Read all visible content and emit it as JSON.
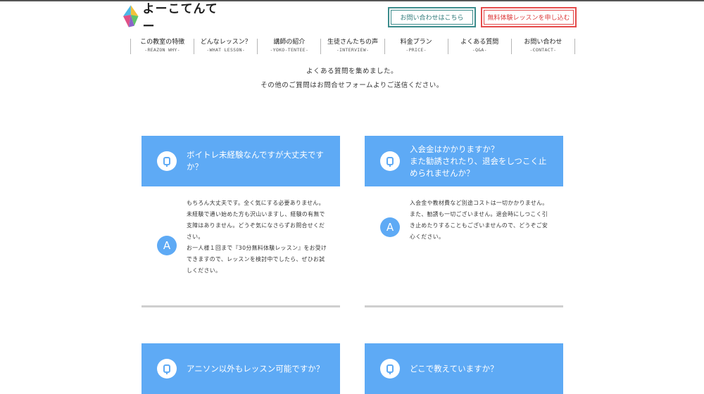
{
  "header": {
    "logo_text": "よーこてんてー",
    "contact_button": "お問い合わせはこちら",
    "trial_button": "無料体験レッスンを申し込む",
    "colors": {
      "contact": "#3c8c8c",
      "trial": "#e44b4b",
      "accent": "#5eaaf5"
    }
  },
  "nav": [
    {
      "ja": "この教室の特徴",
      "en": "-REAZON WHY-"
    },
    {
      "ja": "どんなレッスン？",
      "en": "-WHAT LESSON-"
    },
    {
      "ja": "講師の紹介",
      "en": "-YOKO-TENTEE-"
    },
    {
      "ja": "生徒さんたちの声",
      "en": "-INTERVIEW-"
    },
    {
      "ja": "料金プラン",
      "en": "-PRICE-"
    },
    {
      "ja": "よくある質問",
      "en": "-Q&A-"
    },
    {
      "ja": "お問い合わせ",
      "en": "-CONTACT-"
    }
  ],
  "intro": {
    "line1": "よくある質問を集めました。",
    "line2": "その他のご質問はお問合せフォームよりご送信ください。"
  },
  "faq": [
    {
      "question": "ボイトレ未経験なんですが大丈夫ですか？",
      "answer_lines": [
        "もちろん大丈夫です。全く気にする必要ありません。",
        "未経験で通い始めた方も沢山いますし、経験の有無で支障はありません。どうぞ気になさらずお問合せください。",
        "お一人様１回まで『30分無料体験レッスン』をお受けできますので、レッスンを検討中でしたら、ぜひお試しください。"
      ]
    },
    {
      "question": "入会金はかかりますか？\nまた勧誘されたり、退会をしつこく止められませんか？",
      "answer_lines": [
        "入会金や教材費など別途コストは一切かかりません。",
        "また、勧誘も一切ございません。退会時にしつこく引き止めたりすることもございませんので、どうぞご安心ください。"
      ]
    },
    {
      "question": "アニソン以外もレッスン可能ですか？"
    },
    {
      "question": "どこで教えていますか？"
    }
  ]
}
